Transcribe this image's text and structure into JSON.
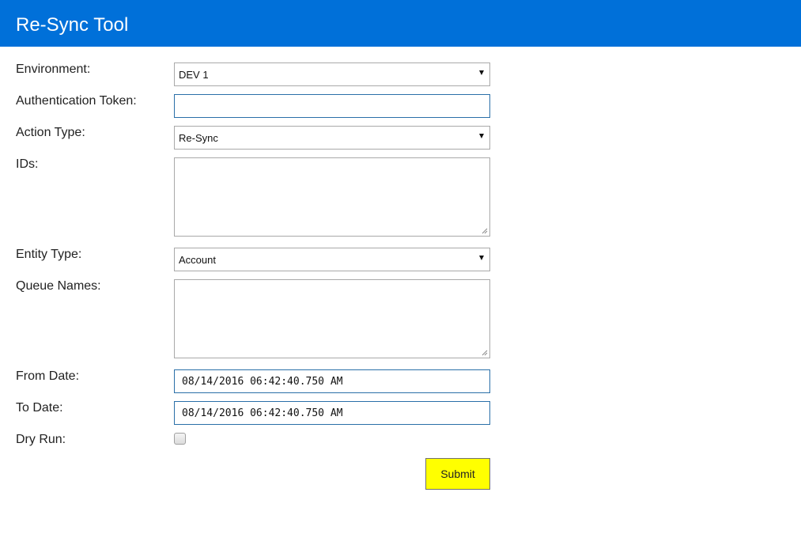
{
  "header": {
    "title": "Re-Sync Tool"
  },
  "form": {
    "environment": {
      "label": "Environment:",
      "value": "DEV 1"
    },
    "auth_token": {
      "label": "Authentication Token:",
      "value": ""
    },
    "action_type": {
      "label": "Action Type:",
      "value": "Re-Sync"
    },
    "ids": {
      "label": "IDs:",
      "value": ""
    },
    "entity_type": {
      "label": "Entity Type:",
      "value": "Account"
    },
    "queue_names": {
      "label": "Queue Names:",
      "value": ""
    },
    "from_date": {
      "label": "From Date:",
      "value": "08/14/2016 06:42:40.750 AM"
    },
    "to_date": {
      "label": "To Date:",
      "value": "08/14/2016 06:42:40.750 AM"
    },
    "dry_run": {
      "label": "Dry Run:",
      "checked": false
    },
    "submit_label": "Submit"
  },
  "colors": {
    "header_bg": "#0070d9",
    "submit_bg": "#ffff00",
    "focus_border": "#2a6fa8"
  }
}
